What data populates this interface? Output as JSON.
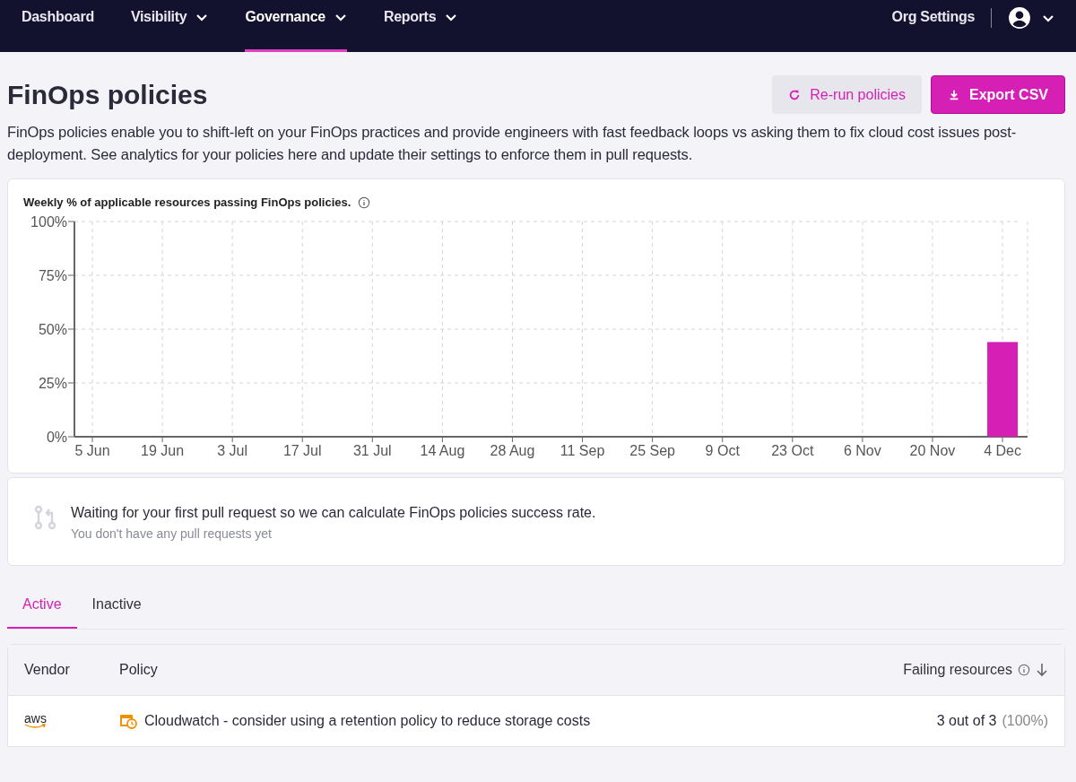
{
  "nav": {
    "items": [
      {
        "label": "Dashboard",
        "has_menu": false,
        "selected": false
      },
      {
        "label": "Visibility",
        "has_menu": true,
        "selected": false
      },
      {
        "label": "Governance",
        "has_menu": true,
        "selected": true
      },
      {
        "label": "Reports",
        "has_menu": true,
        "selected": false
      }
    ],
    "org_settings": "Org Settings"
  },
  "page": {
    "title": "FinOps policies",
    "buttons": [
      {
        "label": "Re-run policies",
        "kind": "secondary"
      },
      {
        "label": "Export CSV",
        "kind": "primary"
      }
    ],
    "description": "FinOps policies enable you to shift-left on your FinOps practices and provide engineers with fast feedback loops vs asking them to fix cloud cost issues post-deployment. See analytics for your policies here and update their settings to enforce them in pull requests."
  },
  "chart_card": {
    "title": "Weekly % of applicable resources passing FinOps policies.",
    "chart_data": {
      "type": "bar",
      "categories": [
        "5 Jun",
        "19 Jun",
        "3 Jul",
        "17 Jul",
        "31 Jul",
        "14 Aug",
        "28 Aug",
        "11 Sep",
        "25 Sep",
        "9 Oct",
        "23 Oct",
        "6 Nov",
        "20 Nov",
        "4 Dec"
      ],
      "grid": true,
      "series": [
        {
          "color": "#d61fb4",
          "values": [
            null,
            null,
            null,
            null,
            null,
            null,
            null,
            null,
            null,
            null,
            null,
            null,
            null,
            44
          ]
        }
      ],
      "ylim": [
        0,
        100
      ],
      "yticks": [
        {
          "value": 0,
          "label": "0%"
        },
        {
          "value": 25,
          "label": "25%"
        },
        {
          "value": 50,
          "label": "50%"
        },
        {
          "value": 75,
          "label": "75%"
        },
        {
          "value": 100,
          "label": "100%"
        }
      ]
    }
  },
  "empty_state": {
    "message": "Waiting for your first pull request so we can calculate FinOps policies success rate.",
    "hint": "You don't have any pull requests yet"
  },
  "tabs": [
    {
      "label": "Active",
      "selected": true
    },
    {
      "label": "Inactive",
      "selected": false
    }
  ],
  "table": {
    "columns": [
      "Vendor",
      "Policy",
      "Failing resources"
    ],
    "rows": [
      {
        "vendor": "aws",
        "policy": "Cloudwatch - consider using a retention policy to reduce storage costs",
        "failing": "3 out of 3",
        "percent": "(100%)"
      }
    ]
  }
}
